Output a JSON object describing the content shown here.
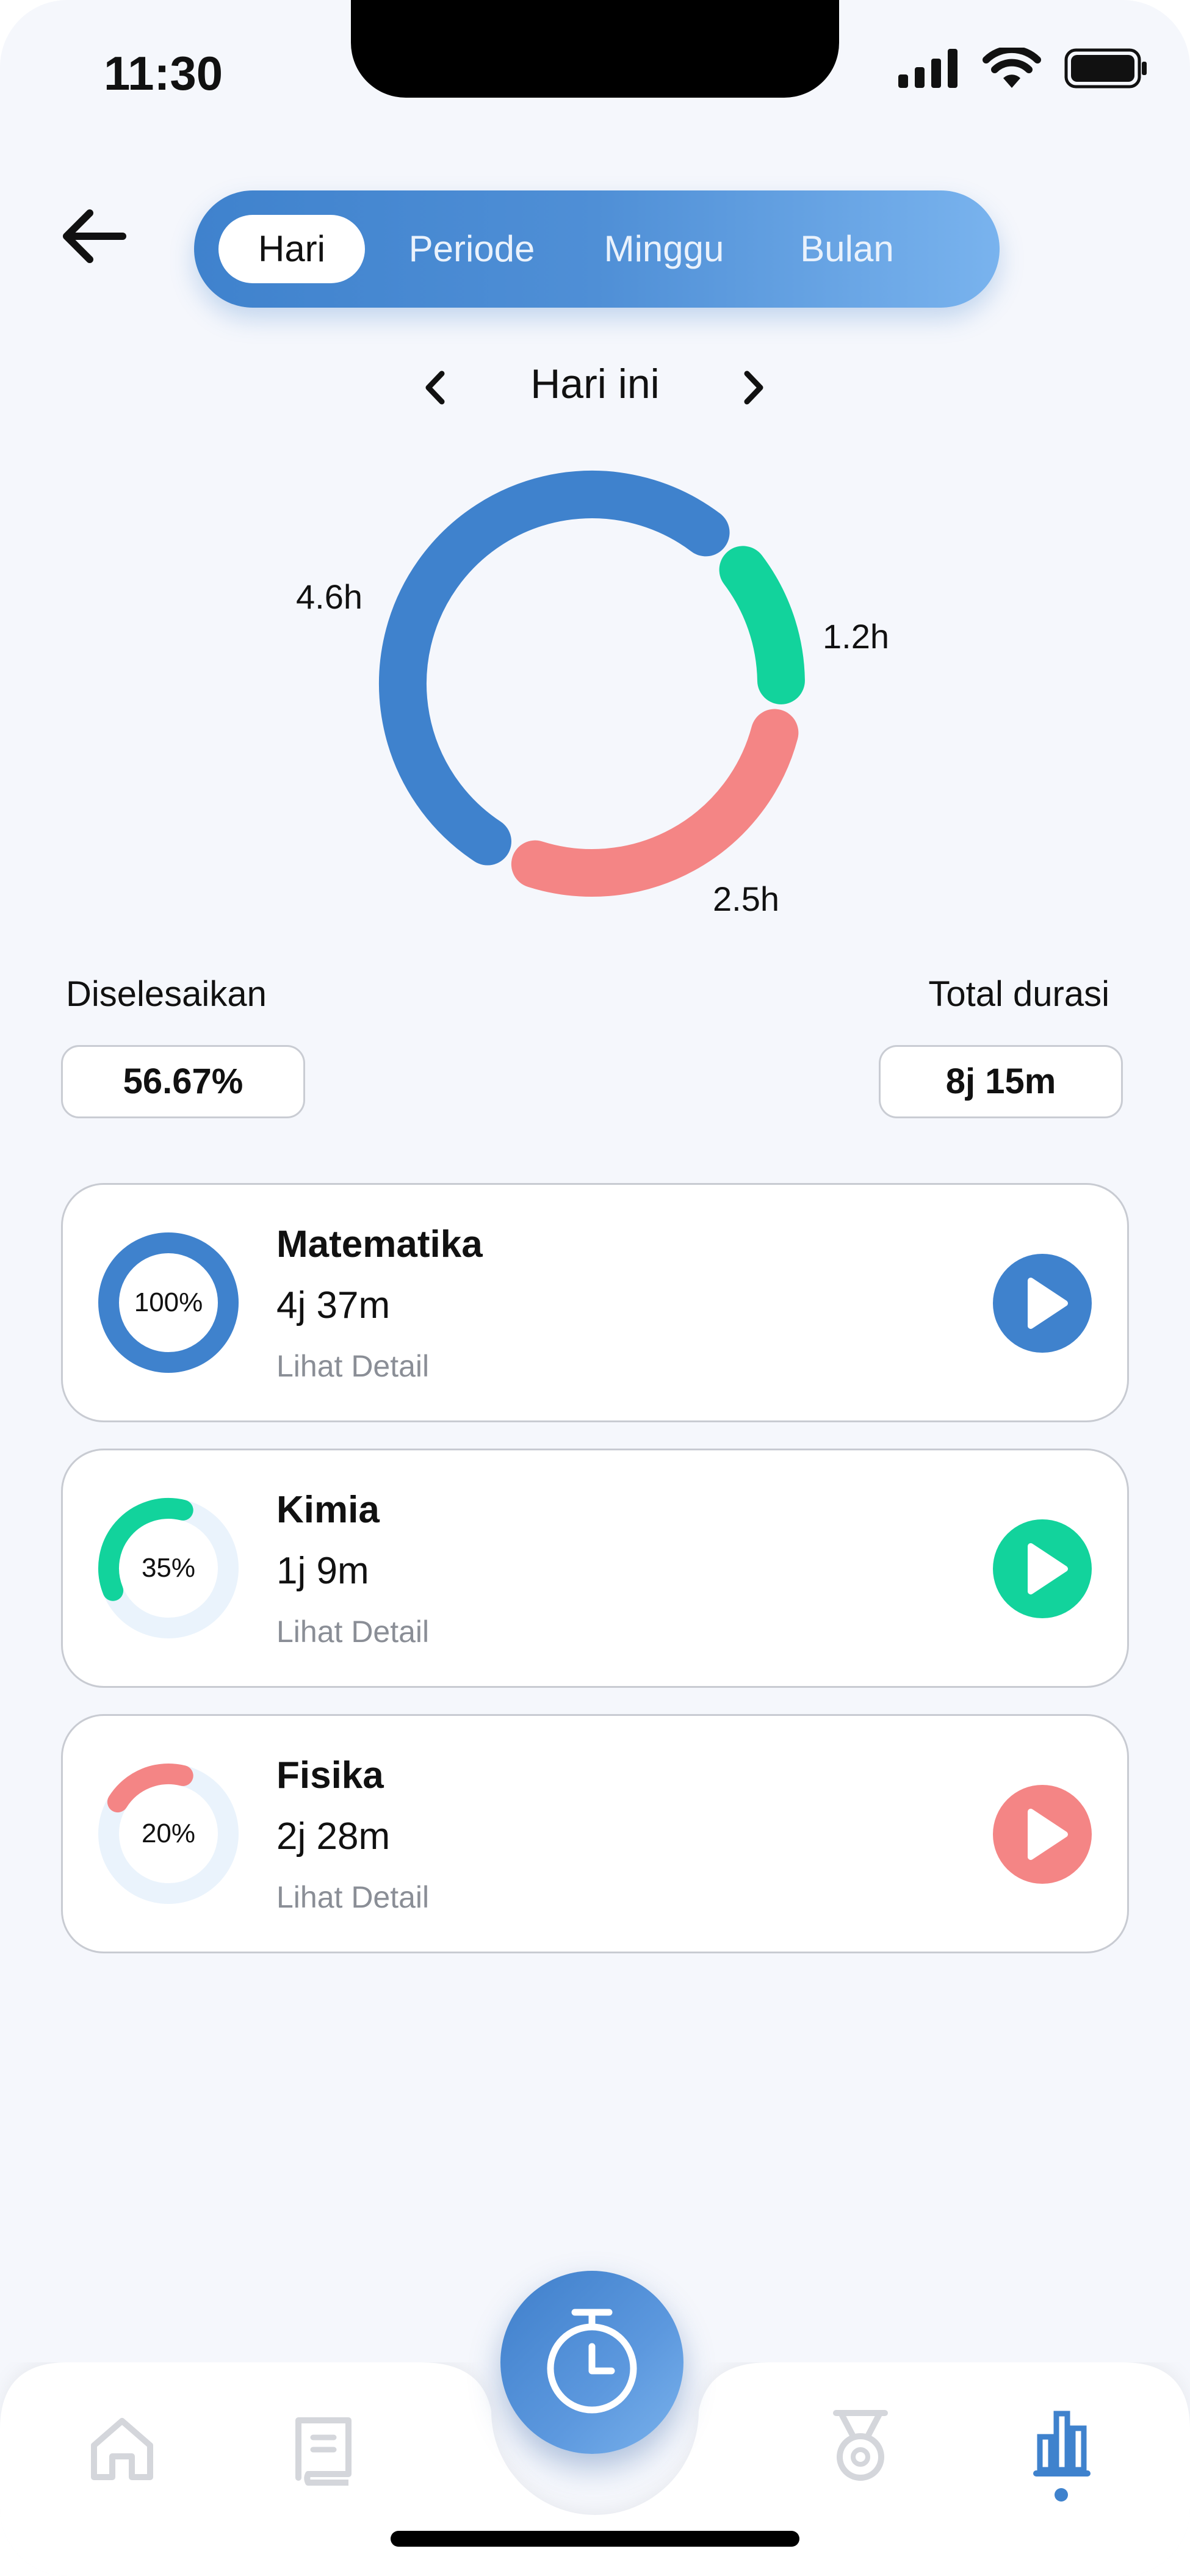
{
  "status_bar": {
    "time": "11:30"
  },
  "tabs": [
    {
      "label": "Hari",
      "active": true
    },
    {
      "label": "Periode",
      "active": false
    },
    {
      "label": "Minggu",
      "active": false
    },
    {
      "label": "Bulan",
      "active": false
    }
  ],
  "date_nav": {
    "label": "Hari ini"
  },
  "donut": {
    "segments": [
      {
        "label": "4.6h",
        "value": 4.6,
        "color": "#3f82cd"
      },
      {
        "label": "1.2h",
        "value": 1.2,
        "color": "#12d39c"
      },
      {
        "label": "2.5h",
        "value": 2.5,
        "color": "#f48585"
      }
    ]
  },
  "stats": {
    "completed_label": "Diselesaikan",
    "completed_value": "56.67%",
    "total_label": "Total durasi",
    "total_value": "8j 15m"
  },
  "subjects": [
    {
      "name": "Matematika",
      "duration": "4j  37m",
      "progress_text": "100%",
      "progress": 1.0,
      "detail": "Lihat Detail",
      "color": "#3f82cd"
    },
    {
      "name": "Kimia",
      "duration": "1j  9m",
      "progress_text": "35%",
      "progress": 0.35,
      "detail": "Lihat Detail",
      "color": "#12d39c"
    },
    {
      "name": "Fisika",
      "duration": "2j  28m",
      "progress_text": "20%",
      "progress": 0.2,
      "detail": "Lihat Detail",
      "color": "#f48585"
    }
  ],
  "colors": {
    "accent": "#3f82cd",
    "green": "#12d39c",
    "red": "#f48585",
    "track": "#eaf3fc",
    "inactive_icon": "#d4d6db"
  },
  "bottom_nav": {
    "items": [
      "home-icon",
      "book-icon",
      "stopwatch-icon",
      "medal-icon",
      "bar-chart-icon"
    ],
    "active": "bar-chart-icon"
  }
}
